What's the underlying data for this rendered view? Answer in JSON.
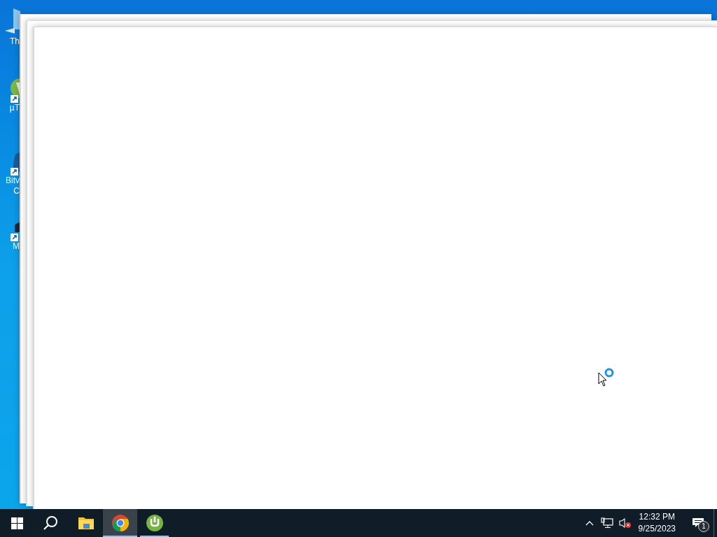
{
  "desktop_icons": [
    {
      "kind": "flag",
      "label_lines": [
        "Th"
      ]
    },
    {
      "kind": "torrent",
      "label_lines": [
        "µT"
      ]
    },
    {
      "kind": "shield",
      "label_lines": [
        "Bitv",
        "C"
      ]
    },
    {
      "kind": "monitor",
      "label_lines": [
        "M"
      ]
    }
  ],
  "windows": [
    {
      "kind": "blank"
    },
    {
      "kind": "blank"
    },
    {
      "kind": "blank"
    }
  ],
  "taskbar": {
    "apps": [
      {
        "kind": "folder",
        "running": false,
        "selected": false
      },
      {
        "kind": "browser",
        "running": true,
        "selected": true
      },
      {
        "kind": "torrent",
        "running": true,
        "selected": false
      }
    ],
    "tray": {
      "volume_muted": true,
      "time": "12:32 PM",
      "date": "9/25/2023",
      "notification_count": "1"
    }
  }
}
